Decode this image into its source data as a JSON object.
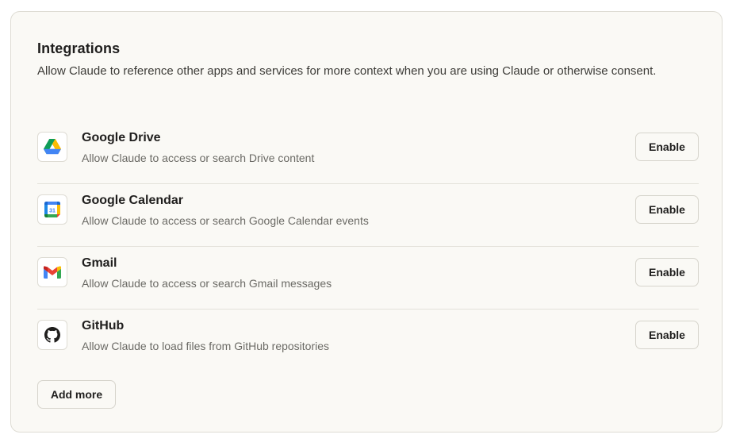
{
  "integrations": {
    "title": "Integrations",
    "description": "Allow Claude to reference other apps and services for more context when you are using Claude or otherwise consent.",
    "items": [
      {
        "name": "Google Drive",
        "description": "Allow Claude to access or search Drive content",
        "icon": "google-drive-icon",
        "button_label": "Enable"
      },
      {
        "name": "Google Calendar",
        "description": "Allow Claude to access or search Google Calendar events",
        "icon": "google-calendar-icon",
        "icon_text": "31",
        "button_label": "Enable"
      },
      {
        "name": "Gmail",
        "description": "Allow Claude to access or search Gmail messages",
        "icon": "gmail-icon",
        "button_label": "Enable"
      },
      {
        "name": "GitHub",
        "description": "Allow Claude to load files from GitHub repositories",
        "icon": "github-icon",
        "button_label": "Enable"
      }
    ],
    "add_more_label": "Add more"
  },
  "colors": {
    "background": "#faf9f5",
    "border": "#dedcd4",
    "text_primary": "#1f1e1d",
    "text_secondary": "#6b6a65"
  }
}
